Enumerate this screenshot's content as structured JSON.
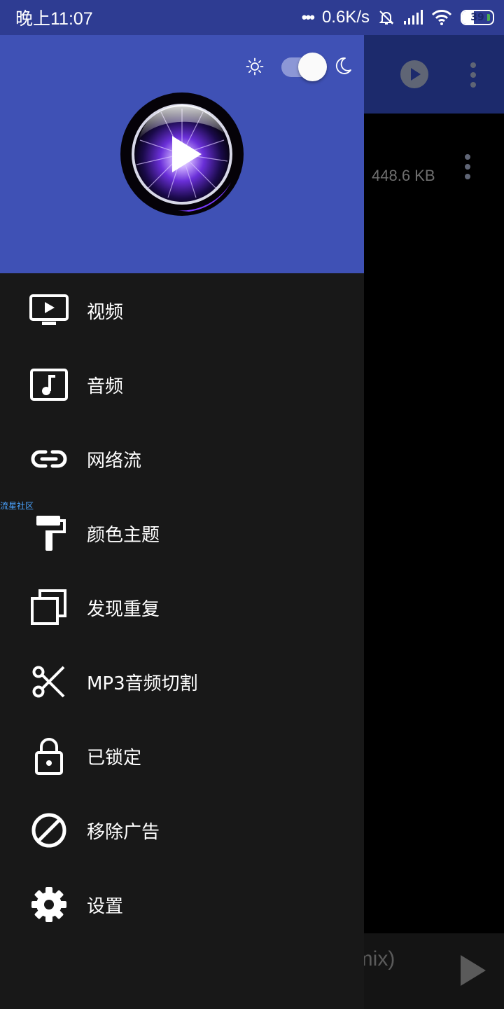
{
  "status_bar": {
    "time": "晚上11:07",
    "dots": "•••",
    "net_speed": "0.6K/s",
    "battery": "39",
    "battery_level_percent": 39
  },
  "background_app": {
    "item_size": "448.6 KB",
    "now_playing_fragment": "emix)"
  },
  "drawer": {
    "theme_toggle": {
      "mode": "dark",
      "on": true
    },
    "menu": [
      {
        "label": "视频",
        "icon": "video-tv-icon"
      },
      {
        "label": "音频",
        "icon": "music-note-icon"
      },
      {
        "label": "网络流",
        "icon": "link-icon"
      },
      {
        "label": "颜色主题",
        "icon": "paint-roller-icon"
      },
      {
        "label": "发现重复",
        "icon": "duplicate-icon"
      },
      {
        "label": "MP3音频切割",
        "icon": "scissors-icon"
      },
      {
        "label": "已锁定",
        "icon": "lock-icon"
      },
      {
        "label": "移除广告",
        "icon": "block-icon"
      },
      {
        "label": "设置",
        "icon": "gear-icon"
      }
    ]
  },
  "watermark": "流星社区",
  "colors": {
    "status_bar": "#2e3c92",
    "drawer_header": "#3f51b5",
    "drawer_body": "#181818",
    "app_bar": "#1c2a6c"
  }
}
